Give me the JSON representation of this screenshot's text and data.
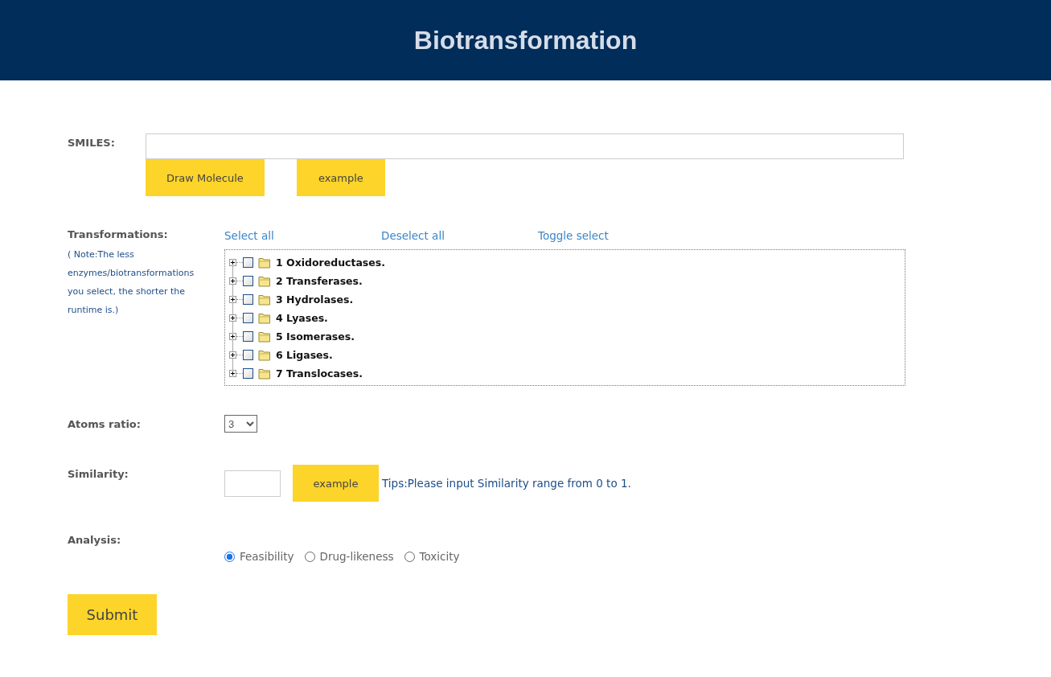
{
  "header": {
    "title": "Biotransformation"
  },
  "smiles": {
    "label": "SMILES:",
    "buttons": [
      "Draw Molecule",
      "example"
    ]
  },
  "transformations": {
    "label": "Transformations:",
    "note": "( Note:The less enzymes/biotransformations you select, the shorter the runtime is.)",
    "links": [
      "Select all",
      "Deselect all",
      "Toggle select"
    ],
    "tree": [
      {
        "label": "1 Oxidoreductases.",
        "checked": false,
        "expanded": false
      },
      {
        "label": "2 Transferases.",
        "checked": false,
        "expanded": false
      },
      {
        "label": "3 Hydrolases.",
        "checked": false,
        "expanded": false
      },
      {
        "label": "4 Lyases.",
        "checked": false,
        "expanded": false
      },
      {
        "label": "5 Isomerases.",
        "checked": false,
        "expanded": false
      },
      {
        "label": "6 Ligases.",
        "checked": false,
        "expanded": false
      },
      {
        "label": "7 Translocases.",
        "checked": false,
        "expanded": false
      }
    ]
  },
  "atoms_ratio": {
    "label": "Atoms ratio:",
    "value": "3"
  },
  "similarity": {
    "label": "Similarity:",
    "button": "example",
    "tip": "Tips:Please input Similarity range from 0 to 1."
  },
  "analysis": {
    "label": "Analysis:",
    "options": [
      {
        "label": "Feasibility",
        "selected": true
      },
      {
        "label": "Drug-likeness",
        "selected": false
      },
      {
        "label": "Toxicity",
        "selected": false
      }
    ]
  },
  "submit": "Submit"
}
